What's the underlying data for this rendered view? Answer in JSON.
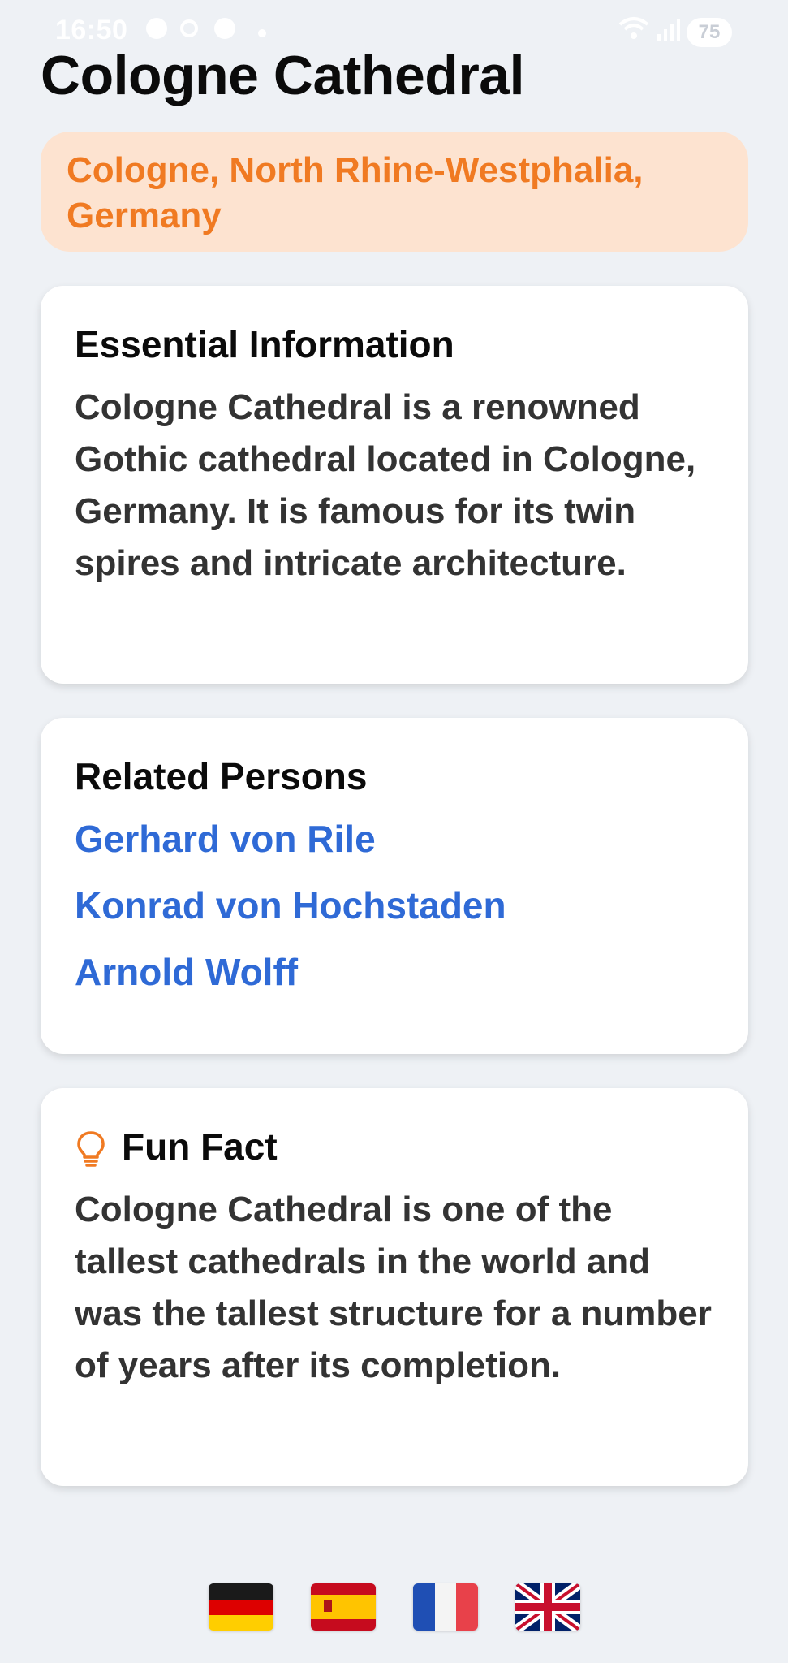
{
  "status_bar": {
    "time": "16:50",
    "battery": "75"
  },
  "landmark": {
    "title": "Cologne Cathedral",
    "location": "Cologne, North Rhine-Westphalia, Germany"
  },
  "essential": {
    "heading": "Essential Information",
    "body": "Cologne Cathedral is a renowned Gothic cathedral located in Cologne, Germany. It is famous for its twin spires and intricate architecture."
  },
  "related": {
    "heading": "Related Persons",
    "persons": [
      "Gerhard von Rile",
      "Konrad von Hochstaden",
      "Arnold Wolff"
    ]
  },
  "fun_fact": {
    "heading": "Fun Fact",
    "icon": "lightbulb-icon",
    "body": "Cologne Cathedral is one of the tallest cathedrals in the world and was the tallest structure for a number of years after its completion."
  },
  "languages": [
    "german-flag",
    "spanish-flag",
    "french-flag",
    "uk-flag"
  ],
  "colors": {
    "background": "#eef1f5",
    "accent_orange": "#f07a22",
    "chip_bg": "#fde3d0",
    "link_blue": "#2f6ad6"
  }
}
